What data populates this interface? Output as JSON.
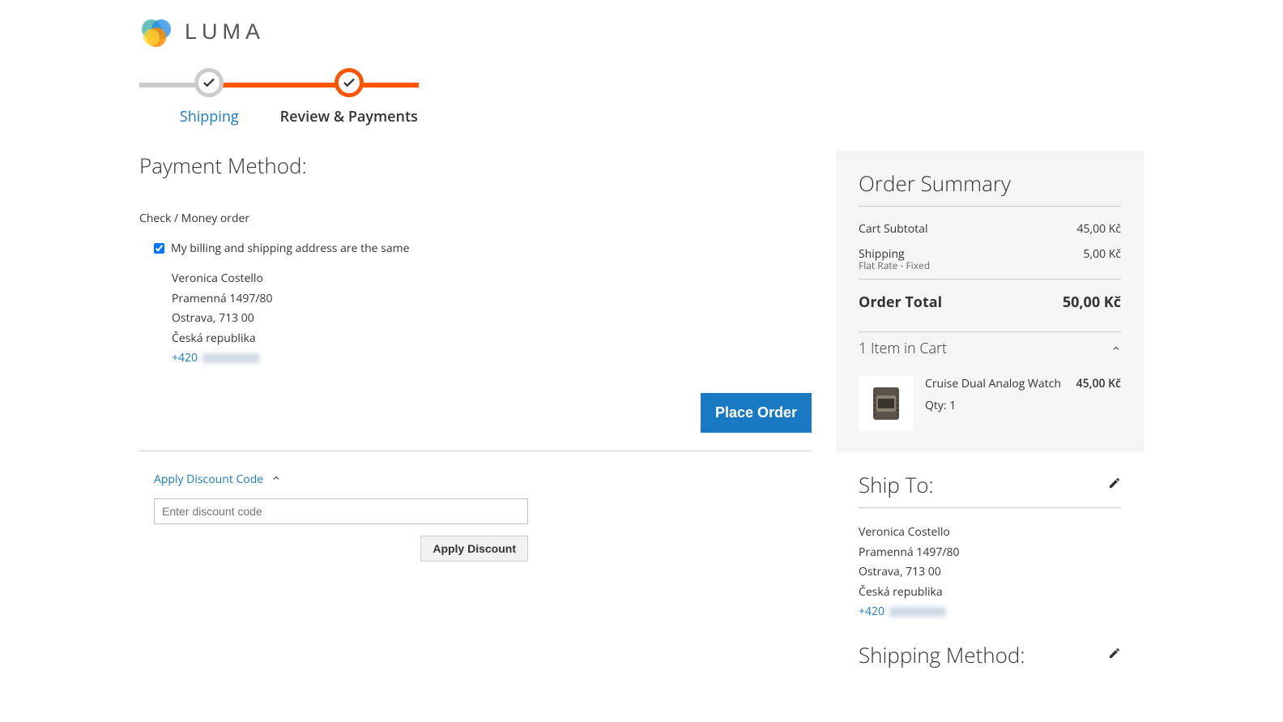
{
  "brand": {
    "name": "LUMA"
  },
  "progress": {
    "steps": [
      {
        "label": "Shipping",
        "active": false
      },
      {
        "label": "Review & Payments",
        "active": true
      }
    ]
  },
  "payment": {
    "title": "Payment Method:",
    "method_name": "Check / Money order",
    "same_address_checkbox_label": "My billing and shipping address are the same",
    "same_address_checked": true,
    "address": {
      "name": "Veronica Costello",
      "street": "Pramenná 1497/80",
      "city_zip": "Ostrava, 713 00",
      "country": "Česká republika",
      "phone_prefix": "+420"
    },
    "place_order_label": "Place Order"
  },
  "discount": {
    "toggle_label": "Apply Discount Code",
    "placeholder": "Enter discount code",
    "apply_label": "Apply Discount"
  },
  "summary": {
    "title": "Order Summary",
    "rows": {
      "subtotal_label": "Cart Subtotal",
      "subtotal_value": "45,00 Kč",
      "shipping_label": "Shipping",
      "shipping_value": "5,00 Kč",
      "shipping_desc": "Flat Rate - Fixed",
      "total_label": "Order Total",
      "total_value": "50,00 Kč"
    },
    "cart_toggle": "1 Item in Cart",
    "items": [
      {
        "name": "Cruise Dual Analog Watch",
        "qty_label": "Qty: 1",
        "price": "45,00 Kč"
      }
    ]
  },
  "ship_to": {
    "title": "Ship To:",
    "address": {
      "name": "Veronica Costello",
      "street": "Pramenná 1497/80",
      "city_zip": "Ostrava, 713 00",
      "country": "Česká republika",
      "phone_prefix": "+420"
    }
  },
  "shipping_method": {
    "title": "Shipping Method:"
  }
}
